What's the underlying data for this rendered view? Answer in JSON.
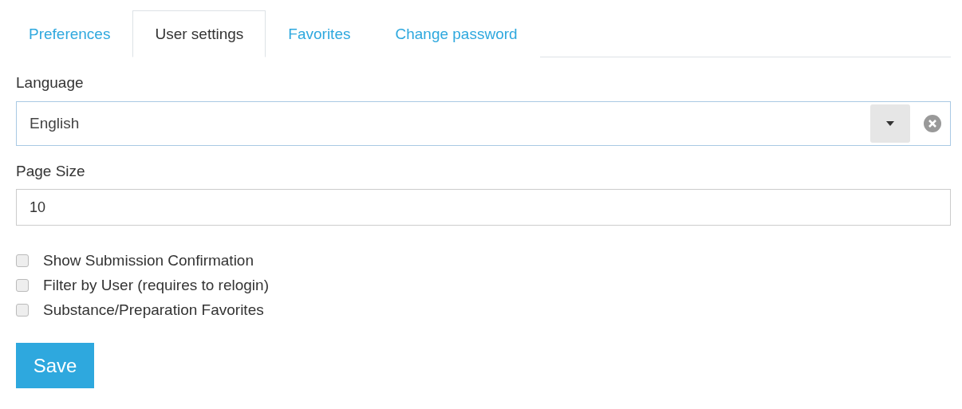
{
  "tabs": [
    {
      "label": "Preferences",
      "selected": false
    },
    {
      "label": "User settings",
      "selected": true
    },
    {
      "label": "Favorites",
      "selected": false
    },
    {
      "label": "Change password",
      "selected": false
    }
  ],
  "language": {
    "label": "Language",
    "value": "English"
  },
  "page_size": {
    "label": "Page Size",
    "value": "10"
  },
  "options": [
    {
      "label": "Show Submission Confirmation",
      "checked": false
    },
    {
      "label": "Filter by User (requires to relogin)",
      "checked": false
    },
    {
      "label": "Substance/Preparation Favorites",
      "checked": false
    }
  ],
  "save_button": "Save"
}
